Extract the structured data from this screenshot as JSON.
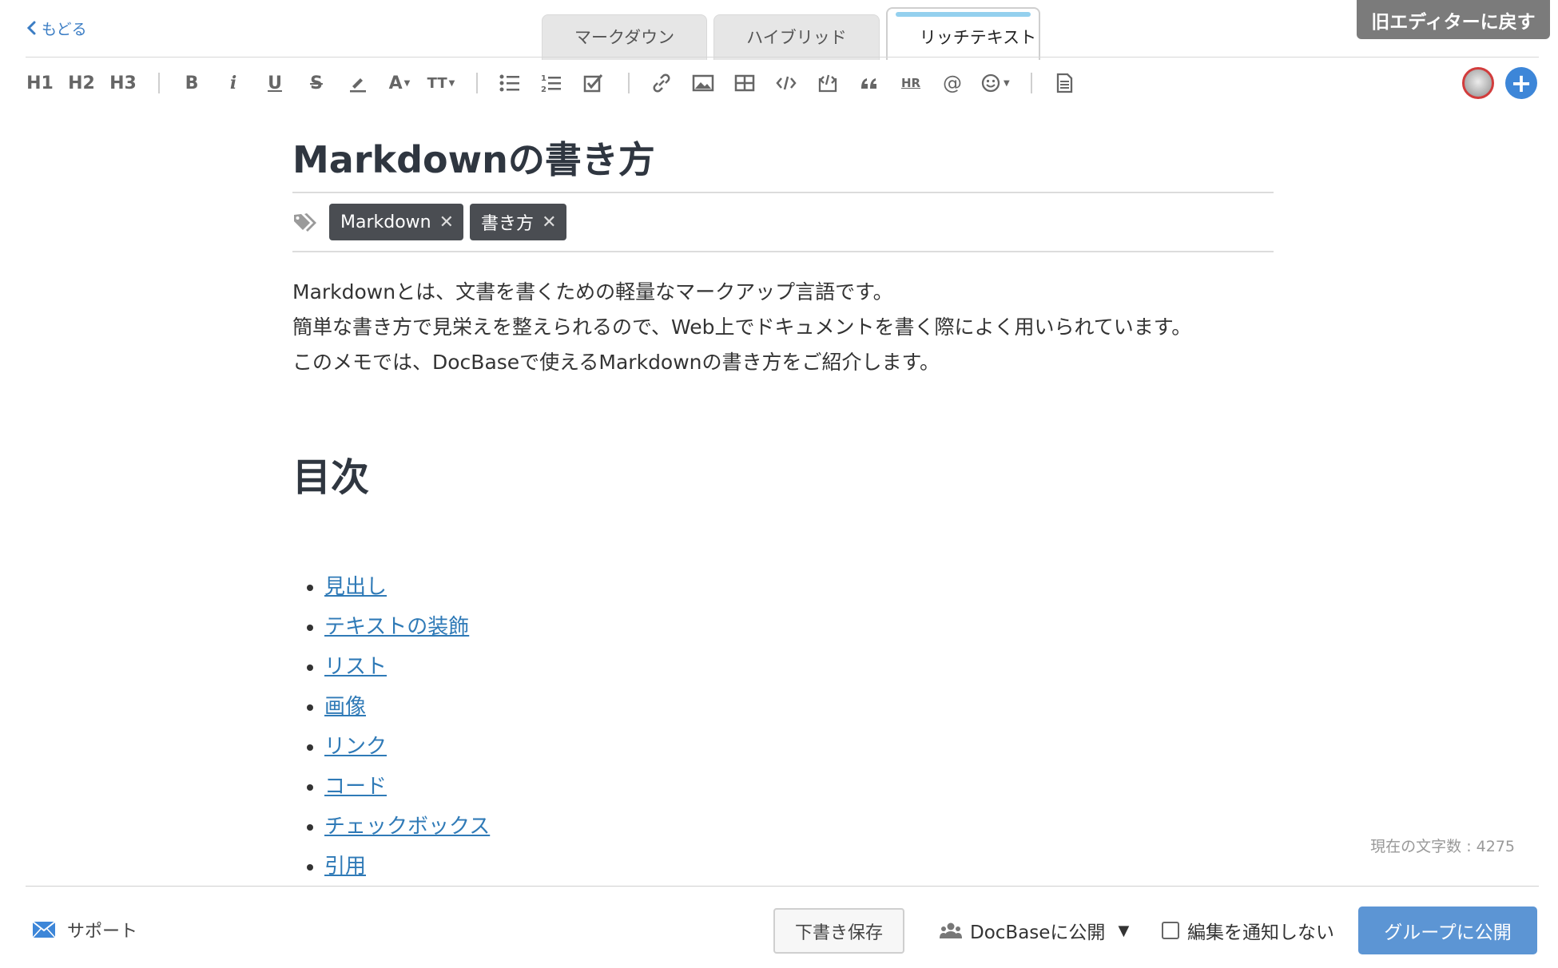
{
  "nav": {
    "back_label": "もどる"
  },
  "tabs": [
    {
      "label": "マークダウン"
    },
    {
      "label": "ハイブリッド"
    },
    {
      "label": "リッチテキスト"
    }
  ],
  "legacy_button": "旧エディターに戻す",
  "toolbar": {
    "h1": "H1",
    "h2": "H2",
    "h3": "H3",
    "bold": "B",
    "italic": "i",
    "underline": "U",
    "strike": "S",
    "font_size": "A",
    "text_size": "TT",
    "hr": "HR",
    "mention": "@"
  },
  "document": {
    "title": "Markdownの書き方",
    "tags": [
      {
        "label": "Markdown"
      },
      {
        "label": "書き方"
      }
    ],
    "paragraphs": [
      "Markdownとは、文書を書くための軽量なマークアップ言語です。",
      "簡単な書き方で見栄えを整えられるので、Web上でドキュメントを書く際によく用いられています。",
      "このメモでは、DocBaseで使えるMarkdownの書き方をご紹介します。"
    ],
    "heading": "目次",
    "toc": [
      {
        "label": "見出し"
      },
      {
        "label": "テキストの装飾"
      },
      {
        "label": "リスト"
      },
      {
        "label": "画像"
      },
      {
        "label": "リンク"
      },
      {
        "label": "コード"
      },
      {
        "label": "チェックボックス"
      },
      {
        "label": "引用"
      }
    ]
  },
  "char_count": "現在の文字数 : 4275",
  "footer": {
    "support": "サポート",
    "draft": "下書き保存",
    "publish_scope": "DocBaseに公開",
    "notify": "編集を通知しない",
    "publish_group": "グループに公開"
  }
}
